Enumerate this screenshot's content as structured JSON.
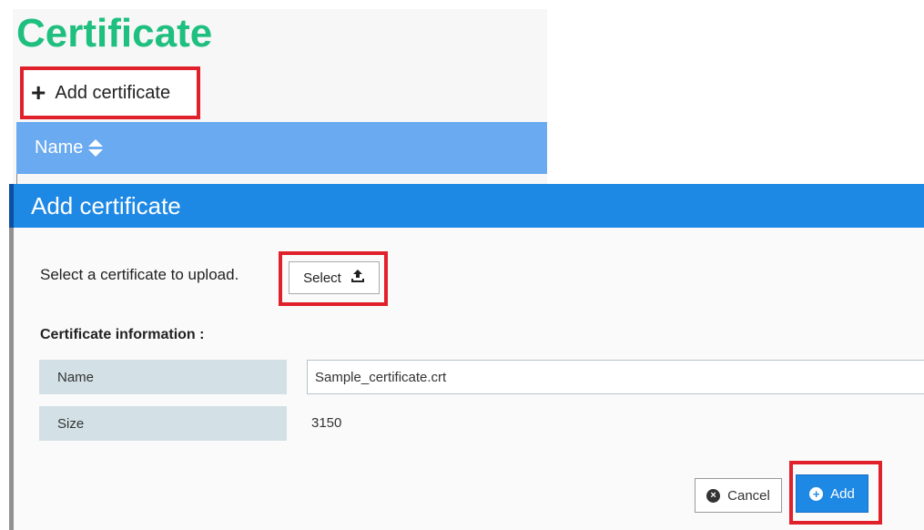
{
  "page": {
    "title": "Certificate",
    "add_link_label": "Add certificate",
    "table": {
      "columns": [
        "Name"
      ]
    }
  },
  "dialog": {
    "title": "Add certificate",
    "select_prompt": "Select a certificate to upload.",
    "select_button": "Select",
    "info_section_label": "Certificate information :",
    "fields": [
      {
        "label": "Name",
        "value": "Sample_certificate.crt"
      },
      {
        "label": "Size",
        "value": "3150"
      }
    ],
    "cancel_button": "Cancel",
    "add_button": "Add"
  },
  "icons": {
    "plus": "plus-icon",
    "sort": "sort-icon",
    "upload": "upload-icon",
    "cancel": "x-circle-icon",
    "add": "plus-circle-icon"
  },
  "colors": {
    "title_green": "#1fbf80",
    "header_blue": "#1e88e5",
    "table_header_blue": "#6aaaf0",
    "highlight_red": "#e0202a"
  }
}
